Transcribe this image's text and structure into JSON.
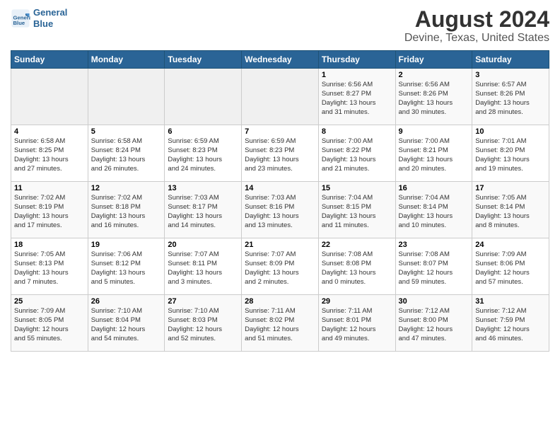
{
  "header": {
    "logo_line1": "General",
    "logo_line2": "Blue",
    "title": "August 2024",
    "subtitle": "Devine, Texas, United States"
  },
  "calendar": {
    "weekdays": [
      "Sunday",
      "Monday",
      "Tuesday",
      "Wednesday",
      "Thursday",
      "Friday",
      "Saturday"
    ],
    "weeks": [
      [
        {
          "day": "",
          "info": ""
        },
        {
          "day": "",
          "info": ""
        },
        {
          "day": "",
          "info": ""
        },
        {
          "day": "",
          "info": ""
        },
        {
          "day": "1",
          "info": "Sunrise: 6:56 AM\nSunset: 8:27 PM\nDaylight: 13 hours\nand 31 minutes."
        },
        {
          "day": "2",
          "info": "Sunrise: 6:56 AM\nSunset: 8:26 PM\nDaylight: 13 hours\nand 30 minutes."
        },
        {
          "day": "3",
          "info": "Sunrise: 6:57 AM\nSunset: 8:26 PM\nDaylight: 13 hours\nand 28 minutes."
        }
      ],
      [
        {
          "day": "4",
          "info": "Sunrise: 6:58 AM\nSunset: 8:25 PM\nDaylight: 13 hours\nand 27 minutes."
        },
        {
          "day": "5",
          "info": "Sunrise: 6:58 AM\nSunset: 8:24 PM\nDaylight: 13 hours\nand 26 minutes."
        },
        {
          "day": "6",
          "info": "Sunrise: 6:59 AM\nSunset: 8:23 PM\nDaylight: 13 hours\nand 24 minutes."
        },
        {
          "day": "7",
          "info": "Sunrise: 6:59 AM\nSunset: 8:23 PM\nDaylight: 13 hours\nand 23 minutes."
        },
        {
          "day": "8",
          "info": "Sunrise: 7:00 AM\nSunset: 8:22 PM\nDaylight: 13 hours\nand 21 minutes."
        },
        {
          "day": "9",
          "info": "Sunrise: 7:00 AM\nSunset: 8:21 PM\nDaylight: 13 hours\nand 20 minutes."
        },
        {
          "day": "10",
          "info": "Sunrise: 7:01 AM\nSunset: 8:20 PM\nDaylight: 13 hours\nand 19 minutes."
        }
      ],
      [
        {
          "day": "11",
          "info": "Sunrise: 7:02 AM\nSunset: 8:19 PM\nDaylight: 13 hours\nand 17 minutes."
        },
        {
          "day": "12",
          "info": "Sunrise: 7:02 AM\nSunset: 8:18 PM\nDaylight: 13 hours\nand 16 minutes."
        },
        {
          "day": "13",
          "info": "Sunrise: 7:03 AM\nSunset: 8:17 PM\nDaylight: 13 hours\nand 14 minutes."
        },
        {
          "day": "14",
          "info": "Sunrise: 7:03 AM\nSunset: 8:16 PM\nDaylight: 13 hours\nand 13 minutes."
        },
        {
          "day": "15",
          "info": "Sunrise: 7:04 AM\nSunset: 8:15 PM\nDaylight: 13 hours\nand 11 minutes."
        },
        {
          "day": "16",
          "info": "Sunrise: 7:04 AM\nSunset: 8:14 PM\nDaylight: 13 hours\nand 10 minutes."
        },
        {
          "day": "17",
          "info": "Sunrise: 7:05 AM\nSunset: 8:14 PM\nDaylight: 13 hours\nand 8 minutes."
        }
      ],
      [
        {
          "day": "18",
          "info": "Sunrise: 7:05 AM\nSunset: 8:13 PM\nDaylight: 13 hours\nand 7 minutes."
        },
        {
          "day": "19",
          "info": "Sunrise: 7:06 AM\nSunset: 8:12 PM\nDaylight: 13 hours\nand 5 minutes."
        },
        {
          "day": "20",
          "info": "Sunrise: 7:07 AM\nSunset: 8:11 PM\nDaylight: 13 hours\nand 3 minutes."
        },
        {
          "day": "21",
          "info": "Sunrise: 7:07 AM\nSunset: 8:09 PM\nDaylight: 13 hours\nand 2 minutes."
        },
        {
          "day": "22",
          "info": "Sunrise: 7:08 AM\nSunset: 8:08 PM\nDaylight: 13 hours\nand 0 minutes."
        },
        {
          "day": "23",
          "info": "Sunrise: 7:08 AM\nSunset: 8:07 PM\nDaylight: 12 hours\nand 59 minutes."
        },
        {
          "day": "24",
          "info": "Sunrise: 7:09 AM\nSunset: 8:06 PM\nDaylight: 12 hours\nand 57 minutes."
        }
      ],
      [
        {
          "day": "25",
          "info": "Sunrise: 7:09 AM\nSunset: 8:05 PM\nDaylight: 12 hours\nand 55 minutes."
        },
        {
          "day": "26",
          "info": "Sunrise: 7:10 AM\nSunset: 8:04 PM\nDaylight: 12 hours\nand 54 minutes."
        },
        {
          "day": "27",
          "info": "Sunrise: 7:10 AM\nSunset: 8:03 PM\nDaylight: 12 hours\nand 52 minutes."
        },
        {
          "day": "28",
          "info": "Sunrise: 7:11 AM\nSunset: 8:02 PM\nDaylight: 12 hours\nand 51 minutes."
        },
        {
          "day": "29",
          "info": "Sunrise: 7:11 AM\nSunset: 8:01 PM\nDaylight: 12 hours\nand 49 minutes."
        },
        {
          "day": "30",
          "info": "Sunrise: 7:12 AM\nSunset: 8:00 PM\nDaylight: 12 hours\nand 47 minutes."
        },
        {
          "day": "31",
          "info": "Sunrise: 7:12 AM\nSunset: 7:59 PM\nDaylight: 12 hours\nand 46 minutes."
        }
      ]
    ]
  }
}
